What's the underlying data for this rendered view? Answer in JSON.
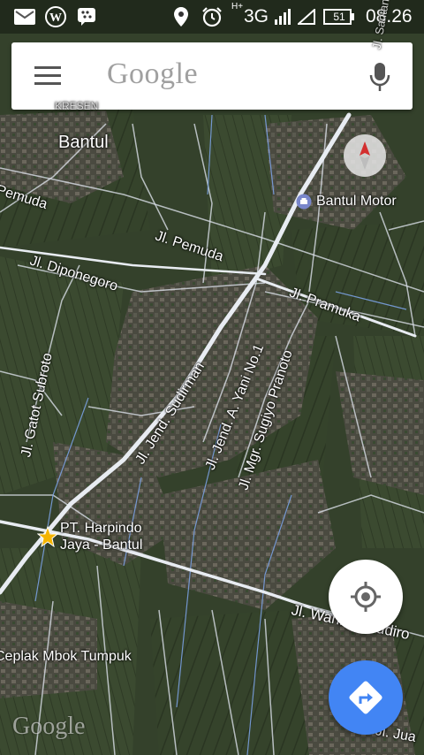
{
  "status_bar": {
    "network": "3G",
    "battery": "51",
    "time": "08.26"
  },
  "search": {
    "placeholder": "Google"
  },
  "map": {
    "places": {
      "kresen": "KRESEN",
      "bantul": "Bantul",
      "bantul_motor": "Bantul Motor",
      "harpindo_line1": "PT. Harpindo",
      "harpindo_line2": "Jaya - Bantul",
      "ceplak": "Ceplak Mbok Tumpuk"
    },
    "roads": {
      "pemuda_left": "Pemuda",
      "pemuda": "Jl. Pemuda",
      "diponegoro": "Jl. Diponegoro",
      "pramuka": "Jl. Pramuka",
      "gatot": "Jl. Gatot Subroto",
      "sudirman": "Jl. Jend. Sudirman",
      "ayani": "Jl. Jend. A. Yani No.1",
      "sugiyo": "Jl. Mgr. Sugiyo Pranoto",
      "wahidin": "Jl. Wahidin Sudiro",
      "juanda": "Jl. Jua",
      "top_right": "Jl. Santan"
    },
    "watermark": "Google"
  },
  "icons": {
    "gmail": "gmail-icon",
    "wordpress": "wordpress-icon",
    "bbm": "bbm-icon",
    "location": "location-icon",
    "alarm": "alarm-icon",
    "signal": "signal-icon",
    "battery": "battery-icon",
    "menu": "menu-icon",
    "mic": "microphone-icon",
    "compass": "compass-icon",
    "my_location": "my-location-icon",
    "directions": "directions-icon"
  },
  "colors": {
    "accent_blue": "#4285f4",
    "compass_red": "#d32f2f",
    "poi_star": "#f4b400"
  }
}
